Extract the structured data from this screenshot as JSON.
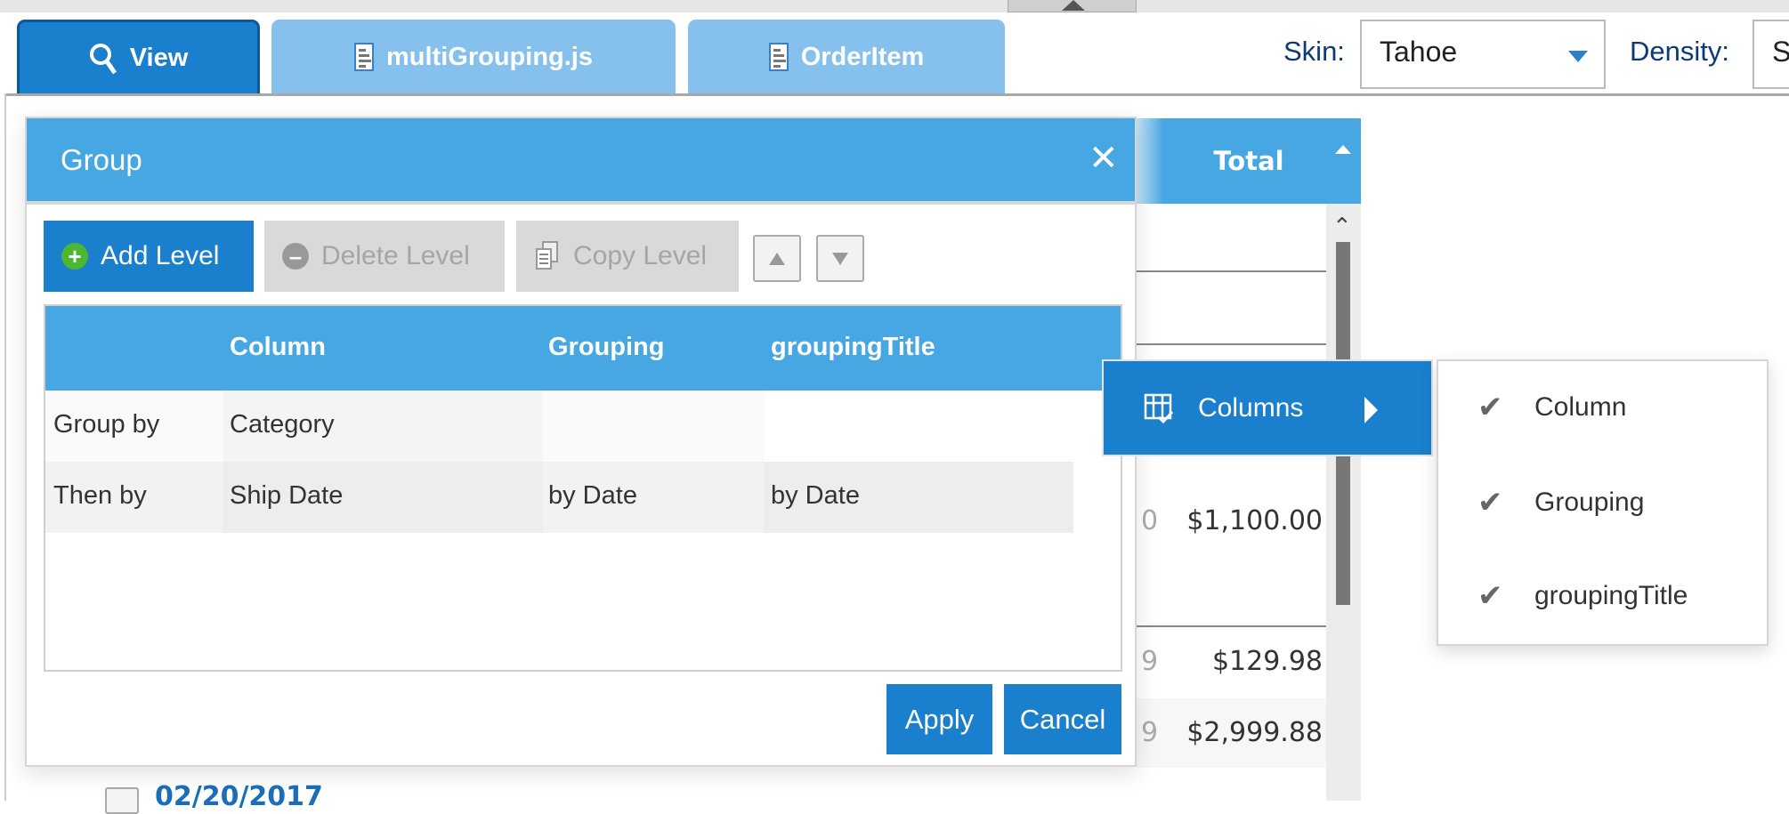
{
  "tabs": [
    {
      "label": "View",
      "icon": "search-icon"
    },
    {
      "label": "multiGrouping.js",
      "icon": "document-icon"
    },
    {
      "label": "OrderItem",
      "icon": "document-icon"
    }
  ],
  "toolbar": {
    "skin_label": "Skin:",
    "skin_value": "Tahoe",
    "density_label": "Density:",
    "density_value": "S"
  },
  "grid": {
    "header": "Total",
    "values": [
      "$1,100.00",
      "$129.98",
      "$2,999.88"
    ],
    "partial": [
      "0",
      "9",
      "9"
    ],
    "date": "02/20/2017"
  },
  "dialog": {
    "title": "Group",
    "add_level": "Add Level",
    "delete_level": "Delete Level",
    "copy_level": "Copy Level",
    "columns": [
      "",
      "Column",
      "Grouping",
      "groupingTitle"
    ],
    "rows": [
      [
        "Group by",
        "Category",
        "",
        ""
      ],
      [
        "Then by",
        "Ship Date",
        "by Date",
        "by Date"
      ]
    ],
    "apply": "Apply",
    "cancel": "Cancel"
  },
  "context_menu": {
    "label": "Columns",
    "items": [
      {
        "label": "Column",
        "checked": true
      },
      {
        "label": "Grouping",
        "checked": true
      },
      {
        "label": "groupingTitle",
        "checked": true
      }
    ]
  },
  "colors": {
    "accent": "#1a7fcc",
    "header": "#47a7e2",
    "tab_inactive": "#86c1ed"
  }
}
